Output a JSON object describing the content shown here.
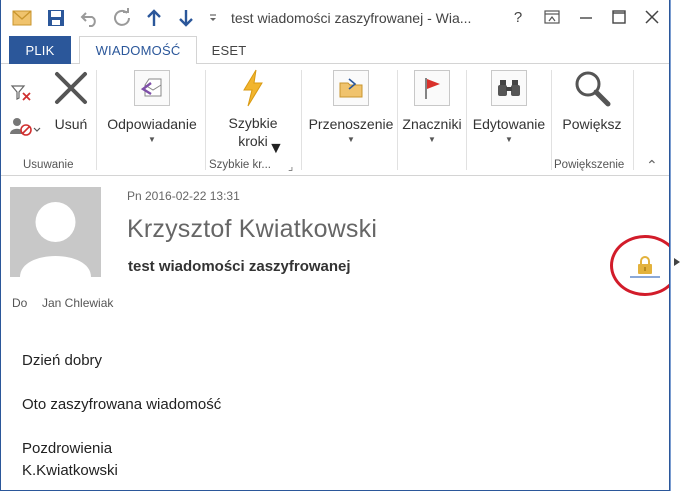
{
  "window": {
    "title": "test wiadomości zaszyfrowanej - Wia...",
    "quick_access": [
      "mail-icon",
      "save-icon",
      "undo-icon",
      "redo-icon",
      "arrow-up-icon",
      "arrow-down-icon",
      "customize-qat-icon"
    ],
    "controls": {
      "help": "?",
      "restore": "⧉",
      "minimize": "—",
      "maximize": "☐",
      "close": "✕"
    }
  },
  "tabs": {
    "file": "PLIK",
    "message": "WIADOMOŚĆ",
    "eset": "ESET"
  },
  "ribbon": {
    "delete_label": "Usuń",
    "groups": {
      "delete": "Usuwanie",
      "quick_steps": "Szybkie kr...",
      "zoom": "Powiększenie"
    },
    "reply_label": "Odpowiadanie",
    "quick_steps_line1": "Szybkie",
    "quick_steps_line2": "kroki",
    "move_label": "Przenoszenie",
    "tags_label": "Znaczniki",
    "editing_label": "Edytowanie",
    "zoom_label": "Powiększ",
    "dialog_launcher": "⌟",
    "collapse": "⌃"
  },
  "message": {
    "sent": "Pn 2016-02-22 13:31",
    "sender": "Krzysztof Kwiatkowski",
    "subject": "test wiadomości zaszyfrowanej",
    "to_label": "Do",
    "to_name": "Jan Chlewiak",
    "encryption_icon": "lock-icon",
    "body": [
      "Dzień dobry",
      "Oto zaszyfrowana wiadomość",
      "Pozdrowienia",
      "K.Kwiatkowski"
    ]
  },
  "colors": {
    "accent": "#2b579a",
    "highlight_circle": "#d21c2a",
    "lock_gold": "#e3b23c",
    "avatar_bg": "#c8c8c8"
  }
}
